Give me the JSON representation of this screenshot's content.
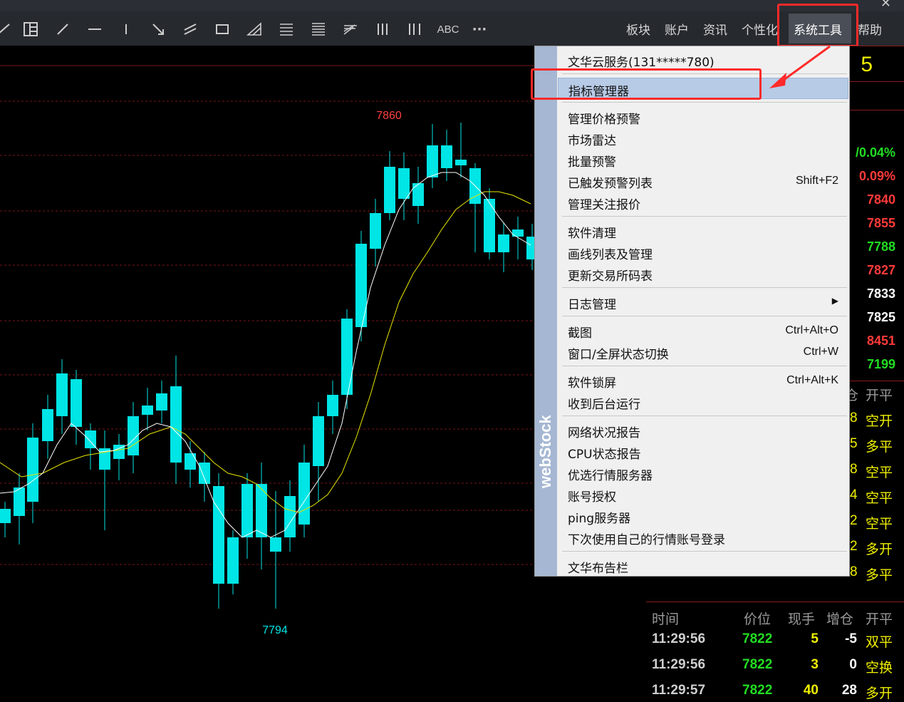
{
  "toolbar": {
    "menus": [
      "板块",
      "账户",
      "资讯",
      "个性化",
      "系统工具",
      "帮助"
    ],
    "abc_label": "ABC",
    "more_label": "···"
  },
  "chart": {
    "high_label": "7860",
    "low_label": "7794",
    "colors": {
      "up": "#ff4040",
      "down": "#00e5e5",
      "ma_fast": "#ffffff",
      "ma_slow": "#e6e600",
      "grid": "#7a1414"
    }
  },
  "menu": {
    "strip_text": "webStock",
    "items": [
      {
        "label": "文华云服务(131*****780)",
        "shortcut": ""
      },
      {
        "label": "指标管理器",
        "shortcut": "",
        "selected": true
      },
      {
        "label": "管理价格预警",
        "shortcut": ""
      },
      {
        "label": "市场雷达",
        "shortcut": ""
      },
      {
        "label": "批量预警",
        "shortcut": ""
      },
      {
        "label": "已触发预警列表",
        "shortcut": "Shift+F2"
      },
      {
        "label": "管理关注报价",
        "shortcut": ""
      },
      {
        "label": "软件清理",
        "shortcut": ""
      },
      {
        "label": "画线列表及管理",
        "shortcut": ""
      },
      {
        "label": "更新交易所码表",
        "shortcut": ""
      },
      {
        "label": "日志管理",
        "shortcut": "",
        "submenu": true
      },
      {
        "label": "截图",
        "shortcut": "Ctrl+Alt+O"
      },
      {
        "label": "窗口/全屏状态切换",
        "shortcut": "Ctrl+W"
      },
      {
        "label": "软件锁屏",
        "shortcut": "Ctrl+Alt+K"
      },
      {
        "label": "收到后台运行",
        "shortcut": ""
      },
      {
        "label": "网络状况报告",
        "shortcut": ""
      },
      {
        "label": "CPU状态报告",
        "shortcut": ""
      },
      {
        "label": "优选行情服务器",
        "shortcut": ""
      },
      {
        "label": "账号授权",
        "shortcut": ""
      },
      {
        "label": "ping服务器",
        "shortcut": ""
      },
      {
        "label": "下次使用自己的行情账号登录",
        "shortcut": ""
      },
      {
        "label": "文华布告栏",
        "shortcut": ""
      }
    ]
  },
  "right_panel": {
    "big_value": "5",
    "pct1": "/0.04%",
    "pct2": "0.09%",
    "values": [
      "7840",
      "7855",
      "7788",
      "7827",
      "7833",
      "7825",
      "8451",
      "7199"
    ],
    "upper_header_tail": "仓",
    "upper_header_kp": "开平",
    "upper_rows": [
      {
        "n": "8",
        "kp": "空开"
      },
      {
        "n": "5",
        "kp": "多平"
      },
      {
        "n": "8",
        "kp": "空平"
      },
      {
        "n": "4",
        "kp": "空平"
      },
      {
        "n": "2",
        "kp": "空平"
      },
      {
        "n": "2",
        "kp": "多开"
      },
      {
        "n": "8",
        "kp": "多平"
      }
    ],
    "trade_headers": [
      "时间",
      "价位",
      "现手",
      "增仓",
      "开平"
    ],
    "trades": [
      {
        "time": "11:29:56",
        "price": "7822",
        "qty": "5",
        "oi": "-5",
        "kp": "双平"
      },
      {
        "time": "11:29:56",
        "price": "7822",
        "qty": "3",
        "oi": "0",
        "kp": "空换"
      },
      {
        "time": "11:29:57",
        "price": "7822",
        "qty": "40",
        "oi": "28",
        "kp": "多开"
      }
    ]
  }
}
